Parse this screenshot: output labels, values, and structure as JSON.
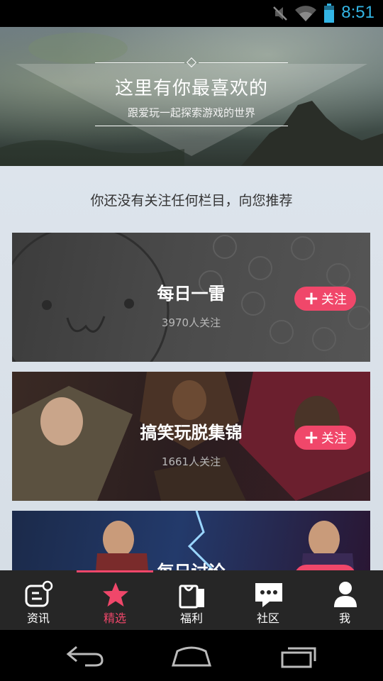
{
  "status_bar": {
    "time": "8:51"
  },
  "hero": {
    "title": "这里有你最喜欢的",
    "subtitle": "跟爱玩一起探索游戏的世界"
  },
  "content": {
    "hint": "你还没有关注任何栏目，向您推荐",
    "cards": [
      {
        "title": "每日一雷",
        "count": "3970人关注",
        "follow_label": "关注"
      },
      {
        "title": "搞笑玩脱集锦",
        "count": "1661人关注",
        "follow_label": "关注"
      },
      {
        "title": "每日讨论",
        "count": "",
        "follow_label": "关注"
      }
    ]
  },
  "tabbar": {
    "active": "精选",
    "items": [
      {
        "label": "资讯",
        "icon": "news-icon"
      },
      {
        "label": "精选",
        "icon": "star-icon"
      },
      {
        "label": "福利",
        "icon": "bag-icon"
      },
      {
        "label": "社区",
        "icon": "chat-icon"
      },
      {
        "label": "我",
        "icon": "person-icon"
      }
    ]
  },
  "colors": {
    "accent": "#f0476a",
    "status_blue": "#33b5e5",
    "tabbar_bg": "#262626"
  }
}
